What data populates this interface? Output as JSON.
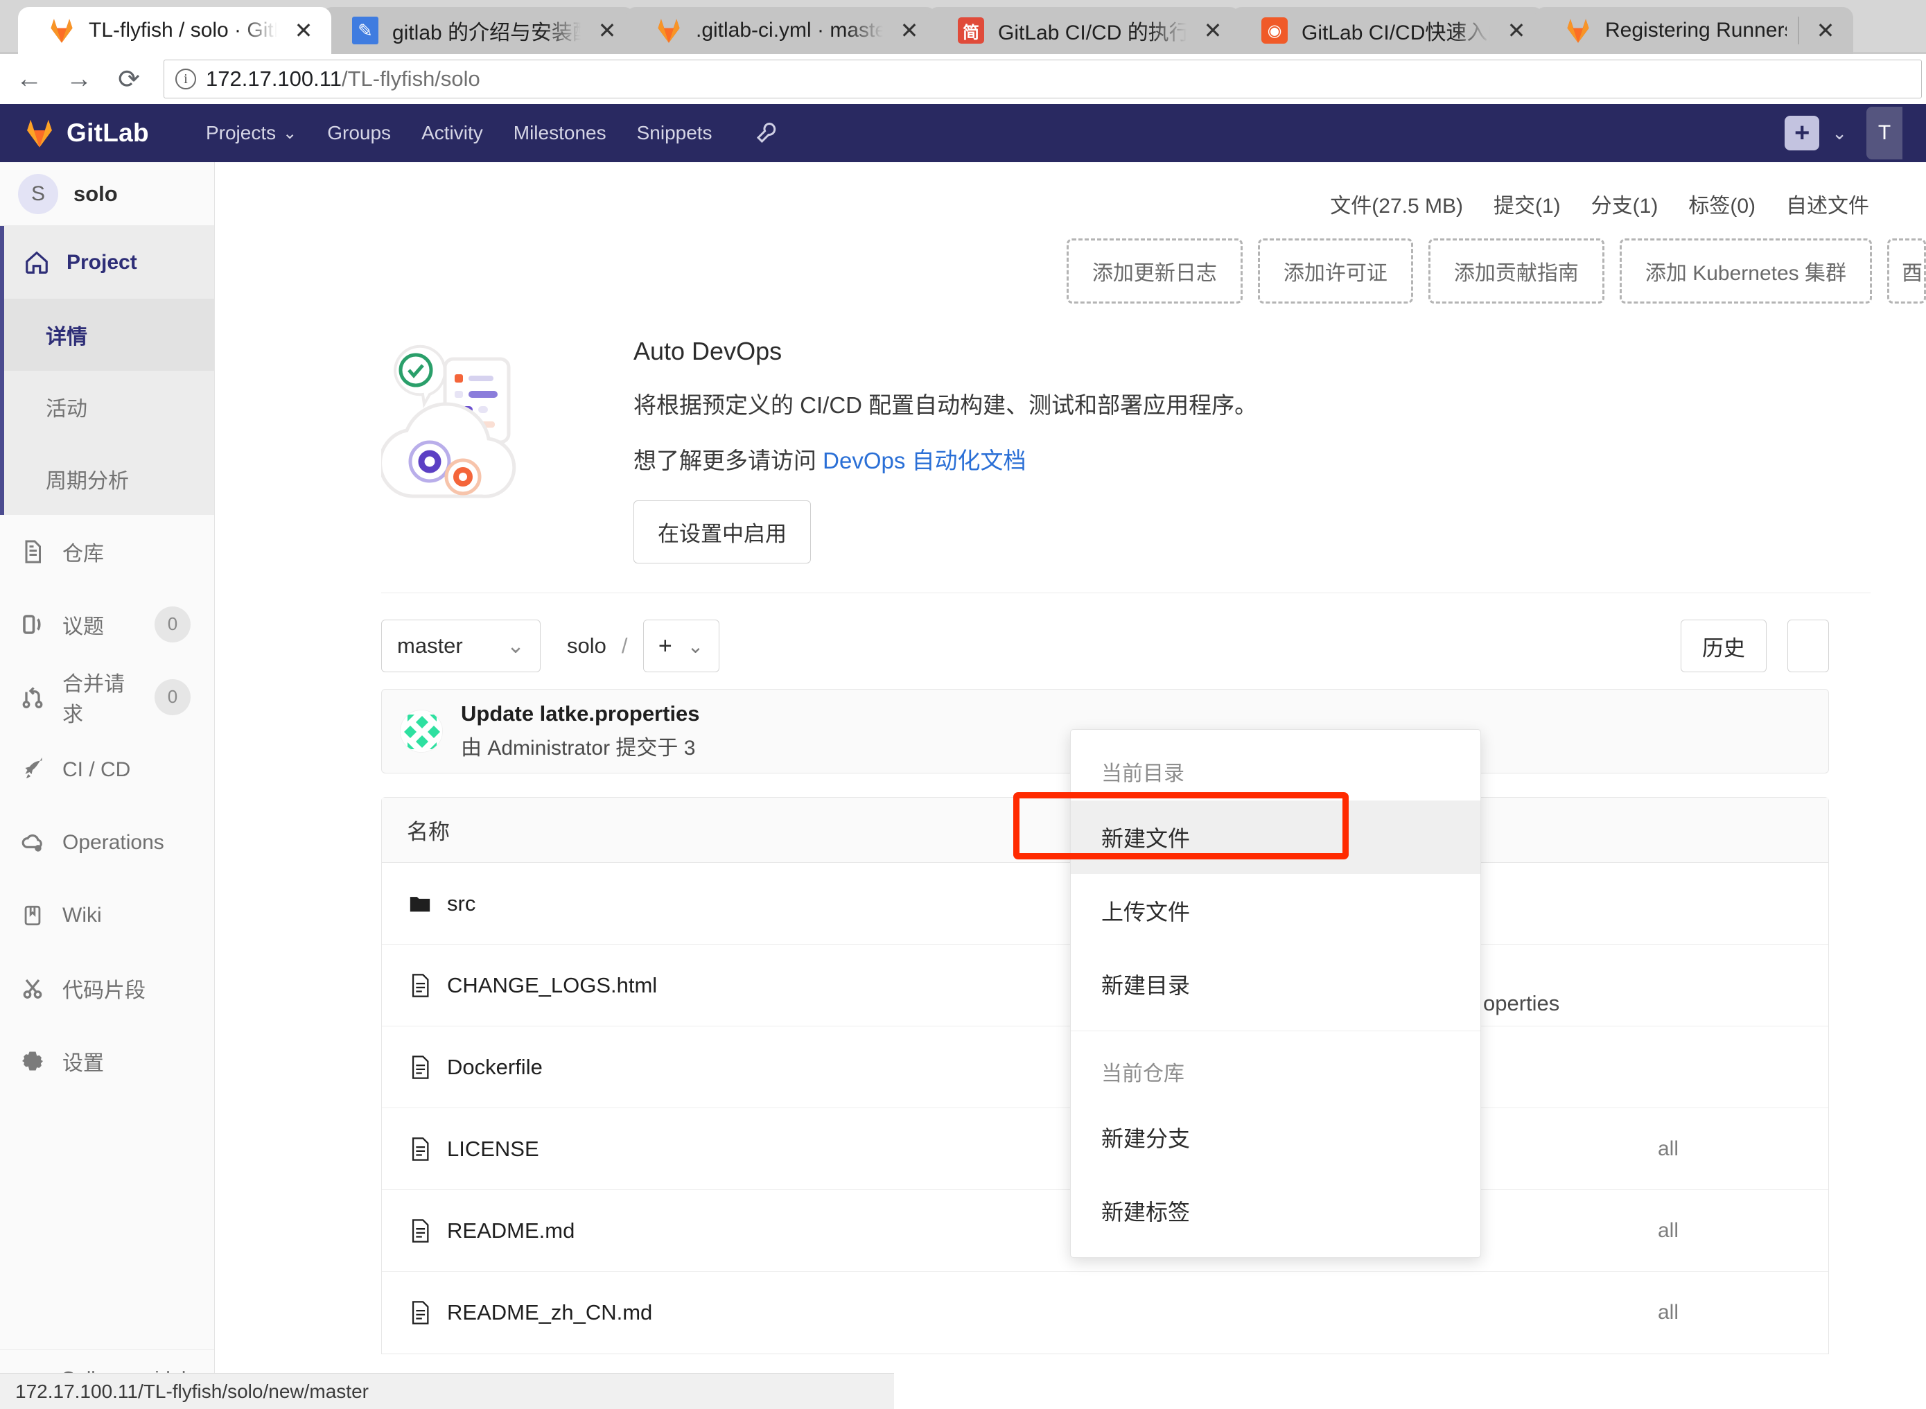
{
  "browser": {
    "tabs": [
      {
        "title": "TL-flyfish / solo · GitLab",
        "favicon": "gitlab-fox-icon",
        "active": true
      },
      {
        "title": "gitlab 的介绍与安装配置",
        "favicon": "blue-feather-icon",
        "active": false
      },
      {
        "title": ".gitlab-ci.yml · master",
        "favicon": "gitlab-fox-icon",
        "active": false
      },
      {
        "title": "GitLab CI/CD 的执行流",
        "favicon": "jianshu-icon",
        "active": false
      },
      {
        "title": "GitLab CI/CD快速入门",
        "favicon": "orange-site-icon",
        "active": false
      },
      {
        "title": "Registering Runners",
        "favicon": "gitlab-fox-icon",
        "active": false
      }
    ],
    "close_label": "✕",
    "back_label": "←",
    "forward_label": "→",
    "reload_label": "⟳",
    "info_label": "i",
    "url_host": "172.17.100.11",
    "url_path": "/TL-flyfish/solo"
  },
  "gitlab_nav": {
    "brand": "GitLab",
    "links": [
      {
        "label": "Projects",
        "has_chevron": true
      },
      {
        "label": "Groups",
        "has_chevron": false
      },
      {
        "label": "Activity",
        "has_chevron": false
      },
      {
        "label": "Milestones",
        "has_chevron": false
      },
      {
        "label": "Snippets",
        "has_chevron": false
      }
    ],
    "wrench_icon": "wrench-icon",
    "plus_label": "+",
    "chevron": "⌄",
    "avatar_initial": "T"
  },
  "sidebar": {
    "project_initial": "S",
    "project_name": "solo",
    "project_header": "Project",
    "sub_items": [
      {
        "label": "详情",
        "active": true
      },
      {
        "label": "活动",
        "active": false
      },
      {
        "label": "周期分析",
        "active": false
      }
    ],
    "items": [
      {
        "label": "仓库",
        "icon": "repository-icon",
        "badge": ""
      },
      {
        "label": "议题",
        "icon": "issues-icon",
        "badge": "0"
      },
      {
        "label": "合并请求",
        "icon": "merge-request-icon",
        "badge": "0"
      },
      {
        "label": "CI / CD",
        "icon": "rocket-icon",
        "badge": ""
      },
      {
        "label": "Operations",
        "icon": "cloud-gear-icon",
        "badge": ""
      },
      {
        "label": "Wiki",
        "icon": "book-icon",
        "badge": ""
      },
      {
        "label": "代码片段",
        "icon": "snippet-icon",
        "badge": ""
      },
      {
        "label": "设置",
        "icon": "gear-icon",
        "badge": ""
      }
    ],
    "collapse_label": "Collapse sidebar",
    "collapse_icon": "double-chevron-left-icon"
  },
  "stats": [
    "文件(27.5 MB)",
    "提交(1)",
    "分支(1)",
    "标签(0)",
    "自述文件"
  ],
  "cta_buttons": [
    "添加更新日志",
    "添加许可证",
    "添加贡献指南",
    "添加 Kubernetes 集群",
    "酉"
  ],
  "auto_devops": {
    "title": "Auto DevOps",
    "description": "将根据预定义的 CI/CD 配置自动构建、测试和部署应用程序。",
    "more_prefix": "想了解更多请访问 ",
    "more_link": "DevOps 自动化文档",
    "enable_button": "在设置中启用"
  },
  "repo": {
    "branch": "master",
    "branch_chevron": "⌄",
    "breadcrumb_root": "solo",
    "breadcrumb_sep": "/",
    "plus_label": "+",
    "plus_chevron": "⌄",
    "history_button": "历史",
    "commit_title": "Update latke.properties",
    "commit_subtitle": "由 Administrator 提交于 3",
    "table_header_name": "名称",
    "files": [
      {
        "name": "src",
        "type": "folder",
        "message": ""
      },
      {
        "name": "CHANGE_LOGS.html",
        "type": "file",
        "message": ""
      },
      {
        "name": "Dockerfile",
        "type": "file",
        "message": ""
      },
      {
        "name": "LICENSE",
        "type": "file",
        "message": "all"
      },
      {
        "name": "README.md",
        "type": "file",
        "message": "all"
      },
      {
        "name": "README_zh_CN.md",
        "type": "file",
        "message": "all"
      }
    ],
    "overflow_text": "operties"
  },
  "dropdown": {
    "group1_label": "当前目录",
    "group1_items": [
      "新建文件",
      "上传文件",
      "新建目录"
    ],
    "highlighted": "新建文件",
    "group2_label": "当前仓库",
    "group2_items": [
      "新建分支",
      "新建标签"
    ]
  },
  "statusbar": {
    "text": "172.17.100.11/TL-flyfish/solo/new/master"
  },
  "colors": {
    "gitlab_navy": "#292961",
    "accent_blue": "#2a6fd6",
    "highlight_red": "#ff2a00",
    "sidebar_bg": "#fafafa"
  }
}
